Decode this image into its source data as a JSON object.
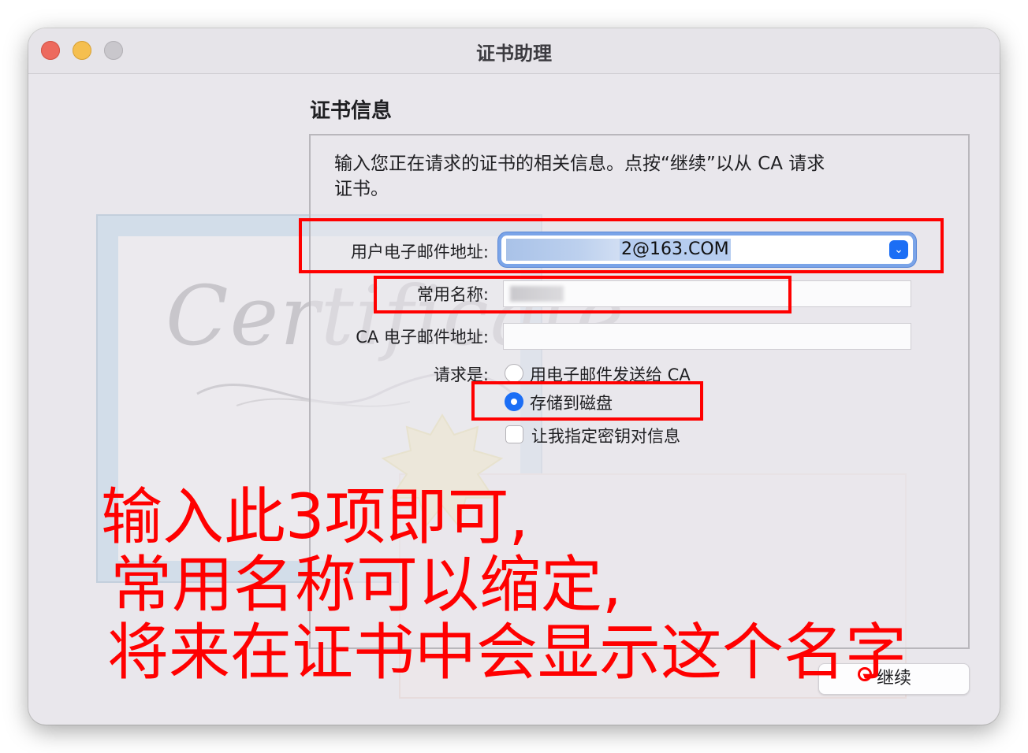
{
  "window": {
    "title": "证书助理"
  },
  "section": {
    "heading": "证书信息"
  },
  "description": {
    "line1": "输入您正在请求的证书的相关信息。点按“继续”以从 CA 请求",
    "line2": "证书。"
  },
  "form": {
    "email_label": "用户电子邮件地址:",
    "email_value": "2@163.COM",
    "common_name_label": "常用名称:",
    "ca_email_label": "CA 电子邮件地址:",
    "request_label": "请求是:",
    "option_email_ca": "用电子邮件发送给 CA",
    "option_save_disk": "存储到磁盘",
    "option_specify_key": "让我指定密钥对信息"
  },
  "buttons": {
    "continue": "继续"
  },
  "annotation": {
    "line1": "输入此3项即可,",
    "line2": "常用名称可以缩定,",
    "line3": "将来在证书中会显示这个名字"
  },
  "background": {
    "certificate_script": "Certificate"
  },
  "colors": {
    "accent": "#1b6ef5",
    "annotation_red": "#ff0000"
  }
}
